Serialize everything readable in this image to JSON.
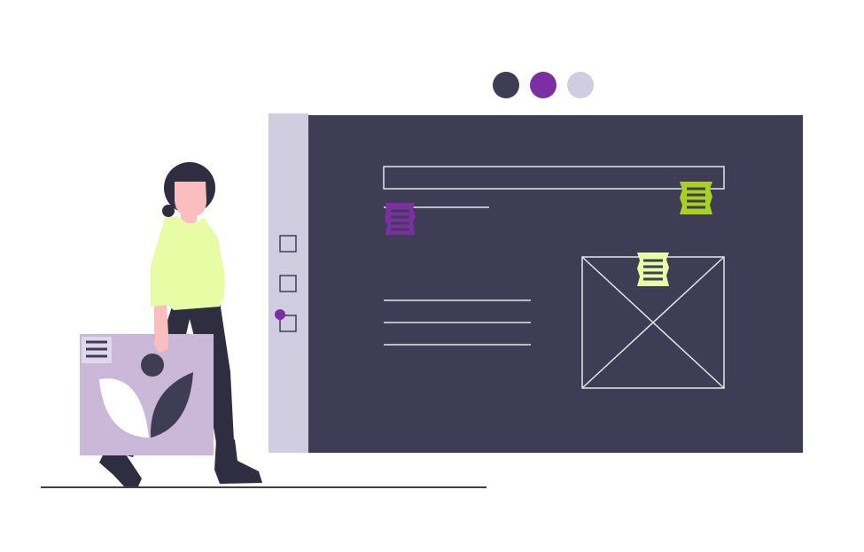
{
  "colors": {
    "dark": "#3f3d56",
    "purple": "#7b2fa3",
    "lavender": "#d0cde1",
    "lime": "#e8fca5",
    "lime_dark": "#a8d21e",
    "white": "#ffffff",
    "skin": "#fbbebe",
    "card": "#cbb8d8"
  },
  "palette_dots": [
    "dark",
    "purple",
    "lavender"
  ],
  "sidebar": {
    "checkboxes": [
      {
        "checked": false
      },
      {
        "checked": false
      },
      {
        "checked": true
      }
    ]
  },
  "canvas": {
    "notes": [
      {
        "color": "purple",
        "icon": "list-icon"
      },
      {
        "color": "lime_dark",
        "icon": "list-icon"
      },
      {
        "color": "lime",
        "icon": "list-icon"
      }
    ],
    "text_lines": 3,
    "image_placeholder": "crossed-box"
  },
  "person": {
    "shirt": "lime",
    "pants": "dark",
    "hair": "dark",
    "card": {
      "icons": [
        "list-icon",
        "leaf-icon"
      ]
    }
  }
}
